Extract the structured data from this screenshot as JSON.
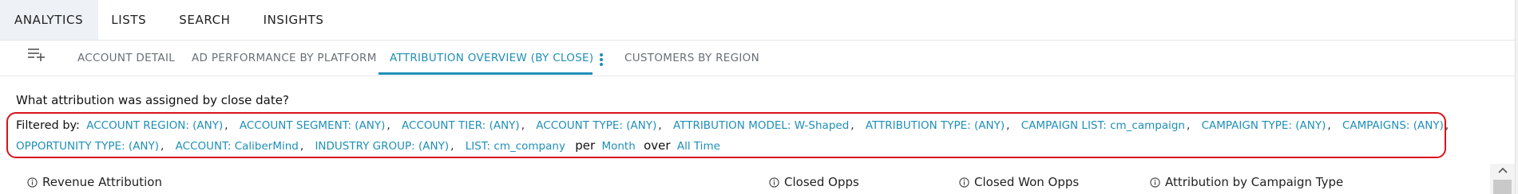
{
  "top_nav": {
    "items": [
      {
        "label": "ANALYTICS",
        "active": true
      },
      {
        "label": "LISTS",
        "active": false
      },
      {
        "label": "SEARCH",
        "active": false
      },
      {
        "label": "INSIGHTS",
        "active": false
      }
    ]
  },
  "tabs": {
    "add_icon": "playlist-add-icon",
    "items": [
      {
        "label": "ACCOUNT DETAIL",
        "active": false
      },
      {
        "label": "AD PERFORMANCE BY PLATFORM",
        "active": false
      },
      {
        "label": "ATTRIBUTION OVERVIEW (BY CLOSE)",
        "active": true
      },
      {
        "label": "CUSTOMERS BY REGION",
        "active": false
      }
    ],
    "more_icon": "kebab-vertical-icon"
  },
  "question": "What attribution was assigned by close date?",
  "filters": {
    "label": "Filtered by:",
    "items": [
      "ACCOUNT REGION: (ANY)",
      "ACCOUNT SEGMENT: (ANY)",
      "ACCOUNT TIER: (ANY)",
      "ACCOUNT TYPE: (ANY)",
      "ATTRIBUTION MODEL: W-Shaped",
      "ATTRIBUTION TYPE: (ANY)",
      "CAMPAIGN LIST: cm_campaign",
      "CAMPAIGN TYPE: (ANY)",
      "CAMPAIGNS: (ANY)",
      "OPPORTUNITY TYPE: (ANY)",
      "ACCOUNT: CaliberMind",
      "INDUSTRY GROUP: (ANY)",
      "LIST: cm_company"
    ],
    "separator": ",",
    "per_label": "per",
    "period": "Month",
    "over_label": "over",
    "range": "All Time"
  },
  "widgets": [
    {
      "title": "Revenue Attribution",
      "icon": "info-icon"
    },
    {
      "title": "Closed Opps",
      "icon": "info-icon"
    },
    {
      "title": "Closed Won Opps",
      "icon": "info-icon"
    },
    {
      "title": "Attribution by Campaign Type",
      "icon": "info-icon"
    }
  ],
  "colors": {
    "accent": "#1f8fb8",
    "highlight_border": "#d8141b",
    "nav_active_bg": "#eef1f5"
  }
}
